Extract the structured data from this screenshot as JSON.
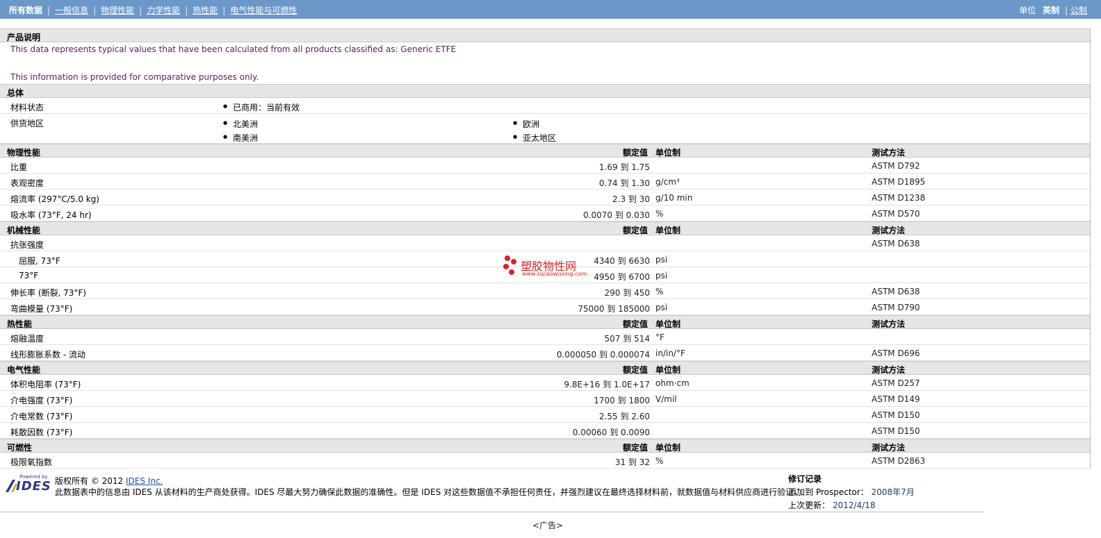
{
  "nav": {
    "tabs": [
      "所有数据",
      "一般信息",
      "物理性能",
      "力学性能",
      "热性能",
      "电气性能与可燃性"
    ],
    "units_label": "单位",
    "units_english": "英制",
    "units_sep": "|",
    "units_metric": "公制"
  },
  "product": {
    "title": "产品说明",
    "desc1": "This data represents typical values that have been calculated from all products classified as: Generic ETFE",
    "desc2": "This information is provided for comparative purposes only."
  },
  "general": {
    "title": "总体",
    "status_label": "材料状态",
    "status_value": "已商用：当前有效",
    "region_label": "供货地区",
    "regions": [
      "北美洲",
      "欧洲",
      "南美洲",
      "亚太地区"
    ]
  },
  "headers": {
    "nominal": "额定值",
    "unit": "单位制",
    "test": "测试方法"
  },
  "sections": [
    {
      "title": "物理性能",
      "rows": [
        {
          "label": "比重",
          "value": "1.69 到  1.75",
          "unit": "",
          "test": "ASTM D792"
        },
        {
          "label": "表观密度",
          "value": "0.74 到  1.30",
          "unit": "g/cm³",
          "test": "ASTM D1895"
        },
        {
          "label": "熔流率  (297°C/5.0 kg)",
          "value": "2.3 到  30",
          "unit": "g/10 min",
          "test": "ASTM D1238"
        },
        {
          "label": "吸水率  (73°F, 24 hr)",
          "value": "0.0070 到  0.030",
          "unit": "%",
          "test": "ASTM D570"
        }
      ]
    },
    {
      "title": "机械性能",
      "rows": [
        {
          "label": "抗张强度",
          "value": "",
          "unit": "",
          "test": "ASTM D638"
        },
        {
          "label": "屈服, 73°F",
          "value": "4340 到  6630",
          "unit": "psi",
          "test": "",
          "indent": true
        },
        {
          "label": "73°F",
          "value": "4950 到  6700",
          "unit": "psi",
          "test": "",
          "indent": true
        },
        {
          "label": "伸长率  (断裂, 73°F)",
          "value": "290 到  450",
          "unit": "%",
          "test": "ASTM D638"
        },
        {
          "label": "弯曲模量  (73°F)",
          "value": "75000 到  185000",
          "unit": "psi",
          "test": "ASTM D790"
        }
      ]
    },
    {
      "title": "热性能",
      "rows": [
        {
          "label": "熔融温度",
          "value": "507 到  514",
          "unit": "°F",
          "test": ""
        },
        {
          "label": "线形膨胀系数  - 流动",
          "value": "0.000050 到  0.000074",
          "unit": "in/in/°F",
          "test": "ASTM D696"
        }
      ]
    },
    {
      "title": "电气性能",
      "rows": [
        {
          "label": "体积电阻率  (73°F)",
          "value": "9.8E+16 到  1.0E+17",
          "unit": "ohm·cm",
          "test": "ASTM D257"
        },
        {
          "label": "介电强度  (73°F)",
          "value": "1700 到  1800",
          "unit": "V/mil",
          "test": "ASTM D149"
        },
        {
          "label": "介电常数  (73°F)",
          "value": "2.55 到  2.60",
          "unit": "",
          "test": "ASTM D150"
        },
        {
          "label": "耗散因数  (73°F)",
          "value": "0.00060 到  0.0090",
          "unit": "",
          "test": "ASTM D150"
        }
      ]
    },
    {
      "title": "可燃性",
      "rows": [
        {
          "label": "极限氧指数",
          "value": "31 到  32",
          "unit": "%",
          "test": "ASTM D2863"
        }
      ]
    }
  ],
  "watermark": {
    "cn": "塑胶物性网",
    "url": "www.sujiaowuxing.com"
  },
  "footer": {
    "logo_small": "Powered by",
    "logo_text": "IDES",
    "copyright": "版权所有  © 2012",
    "company_link": "IDES Inc.",
    "disclaimer": "此数据表中的信息由  IDES 从该材料的生产商处获得。IDES 尽最大努力确保此数据的准确性。但是  IDES 对这些数据值不承担任何责任，并强烈建议在最终选择材料前，就数据值与材料供应商进行验证。",
    "rev_title": "修订记录",
    "added_label": "添加到  Prospector：",
    "added_value": "2008年7月",
    "updated_label": "上次更新：",
    "updated_value": "2012/4/18"
  },
  "ad_label": "<广告>"
}
